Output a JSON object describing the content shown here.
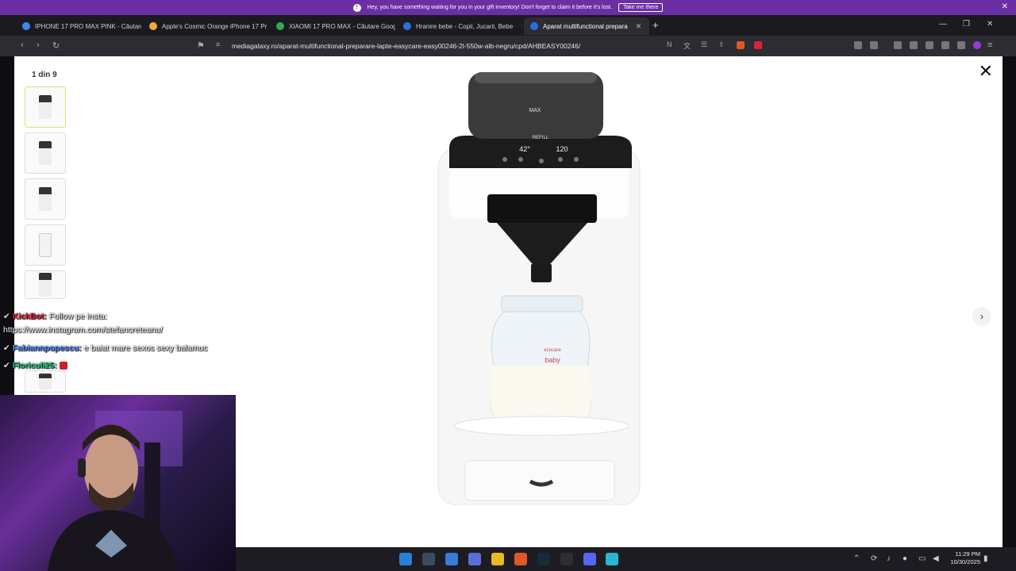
{
  "notification": {
    "text": "Hey, you have something waiting for you in your gift inventory! Don't forget to claim it before it's lost.",
    "button": "Take me there"
  },
  "tabs": [
    {
      "label": "IPHONE 17 PRO MAX PINK - Căutare",
      "color": "#4285f4"
    },
    {
      "label": "Apple's Cosmic Orange iPhone 17 Pr",
      "color": "#f4a742"
    },
    {
      "label": "XIAOMI 17 PRO MAX - Căutare Goog",
      "color": "#34a853"
    },
    {
      "label": "Hranire bebe - Copii, Jucarii, Bebe",
      "color": "#2b6de3"
    },
    {
      "label": "Aparat multifunctional prepara",
      "color": "#2b6de3"
    }
  ],
  "address_bar": {
    "url": "mediagalaxy.ro/aparat-multifunctional-preparare-lapte-easycare-easy00246-2l-550w-alb-negru/cpd/AHBEASY00246/"
  },
  "gallery": {
    "counter": "1 din 9",
    "thumbnail_count_visible": 5,
    "selected_index": 0
  },
  "product_image": {
    "max_label": "MAX",
    "refill_label": "REFILL",
    "display_left": "42°",
    "display_right": "120",
    "bottle_brand": "ecocare",
    "bottle_text": "baby"
  },
  "chat": [
    {
      "user": "KickBot:",
      "message": "Follow pe insta:",
      "user_color": "#e0152f"
    },
    {
      "user": "",
      "message": "https://www.instagram.com/stefancreteanu/",
      "user_color": ""
    },
    {
      "user": "Fabiannpopescu:",
      "message": "e baiat mare sexos sexy balamuc",
      "user_color": "#4d8bff"
    },
    {
      "user": "Floriculi25:",
      "message": "",
      "user_color": "#16c07a"
    }
  ],
  "taskbar": {
    "time": "11:29 PM",
    "date": "10/30/2025"
  },
  "colors": {
    "notification_bg": "#6b2fa3",
    "tab_bg": "#1b1b1f",
    "toolbar_bg": "#2c2c33"
  }
}
